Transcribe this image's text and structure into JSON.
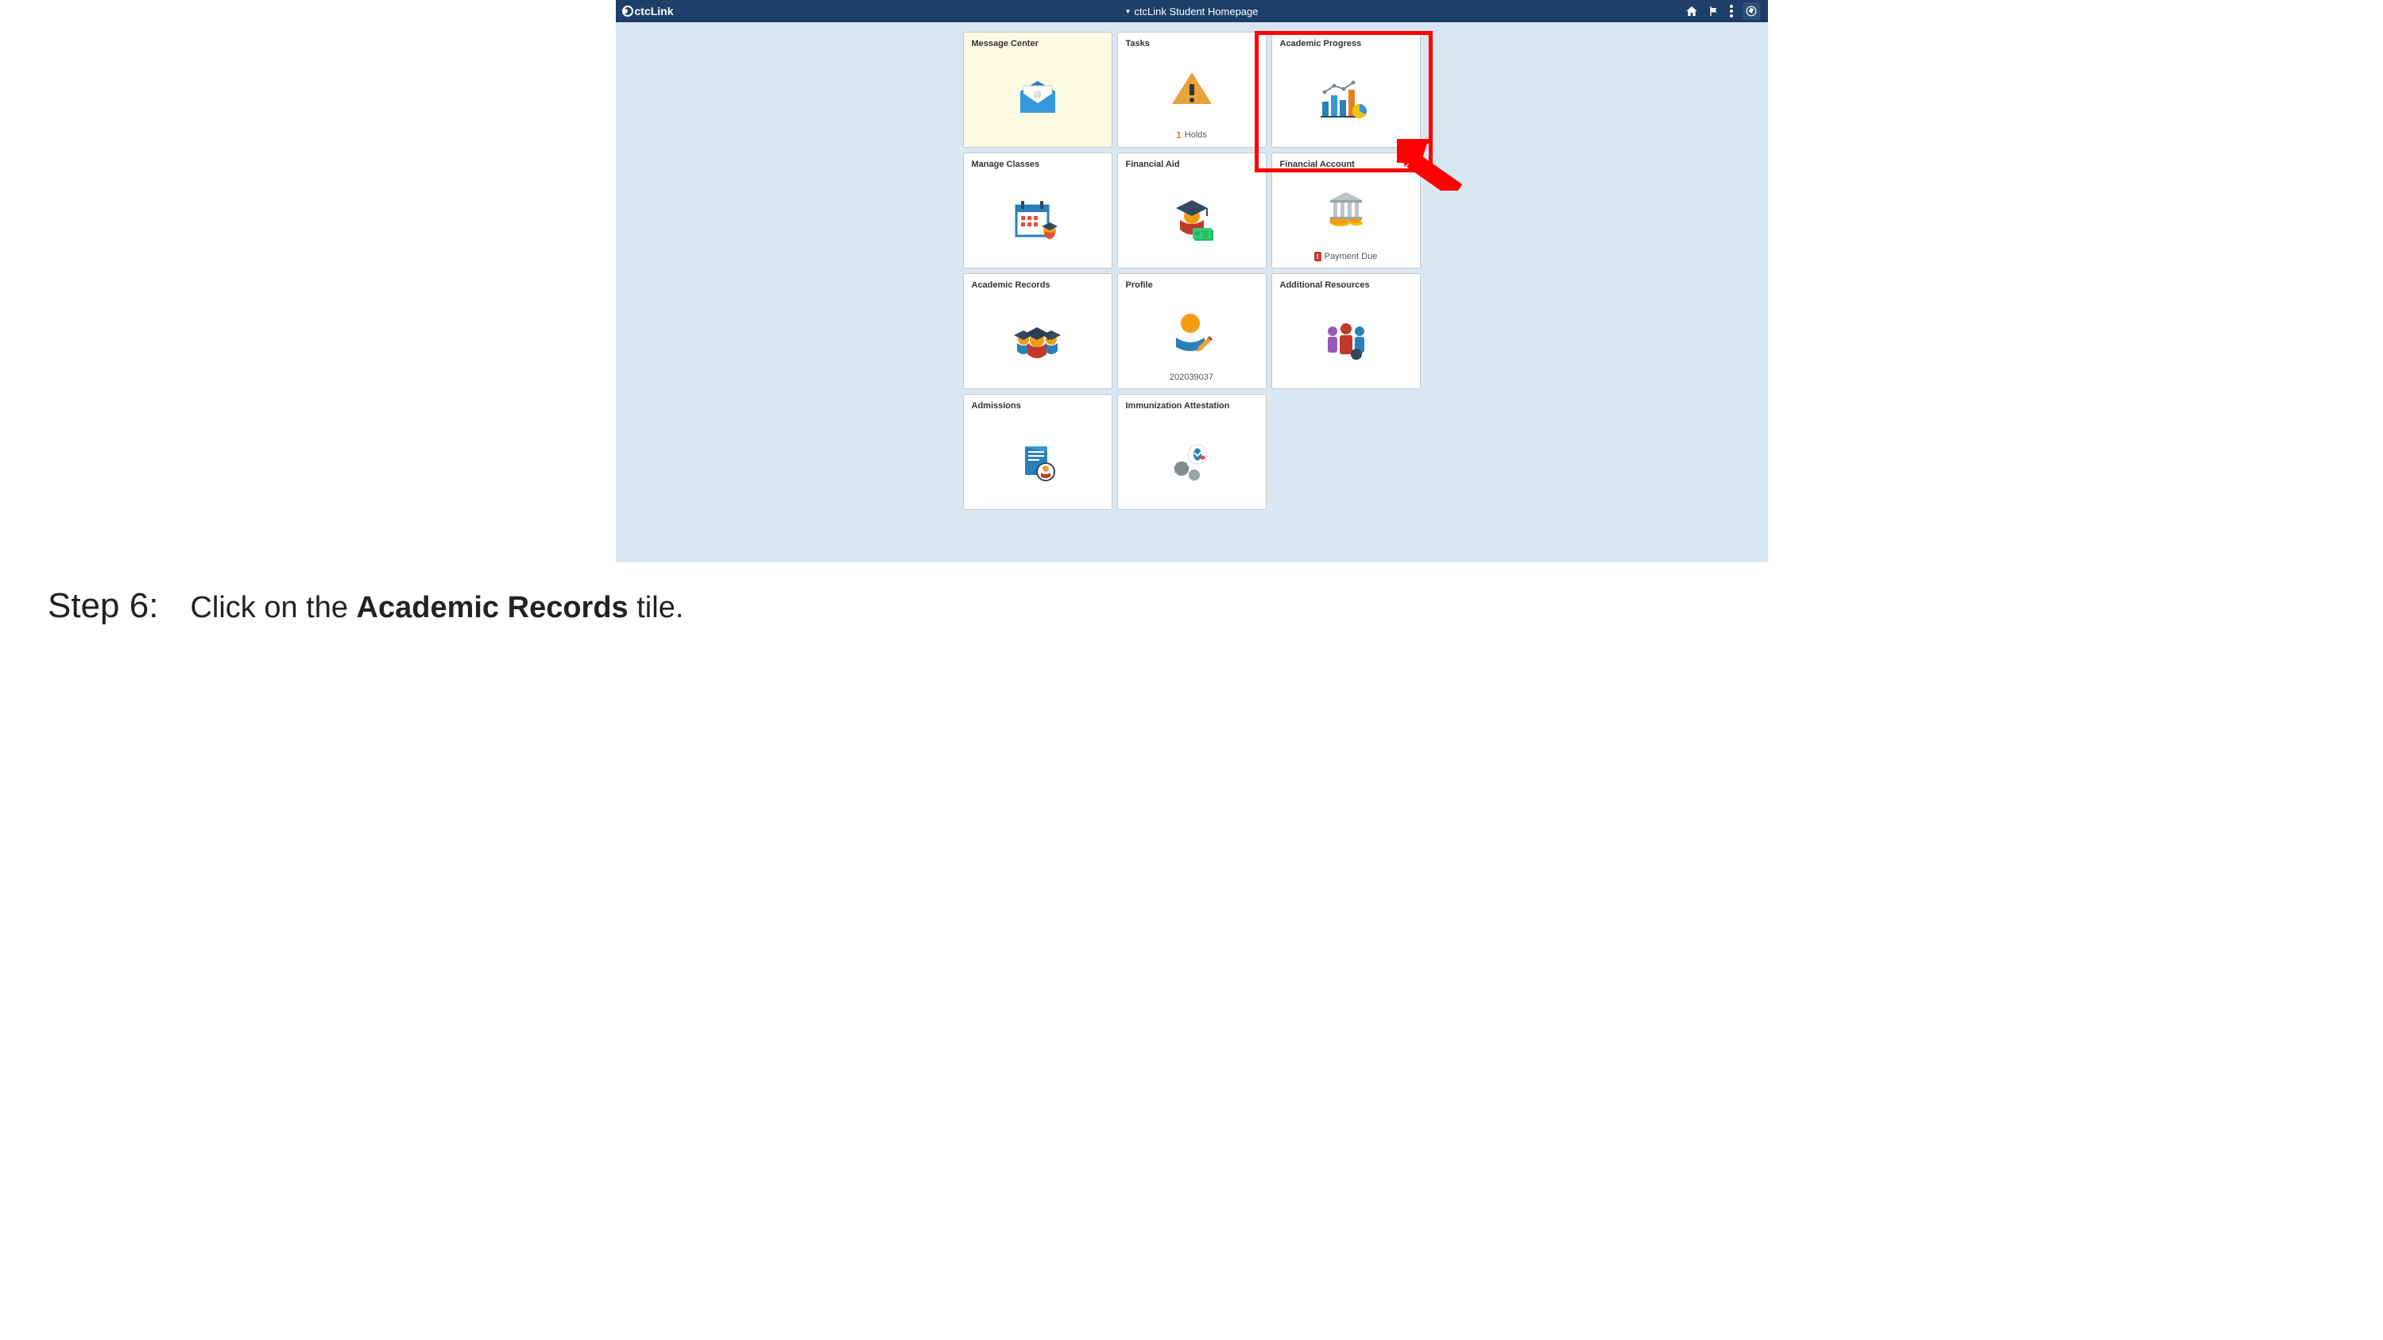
{
  "header": {
    "brand": "ctcLink",
    "title": "ctcLink Student Homepage"
  },
  "tiles": [
    {
      "title": "Message Center",
      "style": "yellow"
    },
    {
      "title": "Tasks",
      "footer_num": "1",
      "footer_text": "Holds"
    },
    {
      "title": "Academic Progress",
      "highlighted": true
    },
    {
      "title": "Manage Classes"
    },
    {
      "title": "Financial Aid"
    },
    {
      "title": "Financial Account",
      "footer_badge": "!",
      "footer_text": "Payment Due"
    },
    {
      "title": "Academic Records"
    },
    {
      "title": "Profile",
      "footer_text": "202039037"
    },
    {
      "title": "Additional Resources"
    },
    {
      "title": "Admissions"
    },
    {
      "title": "Immunization Attestation"
    }
  ],
  "instruction": {
    "step": "Step 6:",
    "prefix": "Click on the ",
    "bold": "Academic Records",
    "suffix": " tile."
  }
}
